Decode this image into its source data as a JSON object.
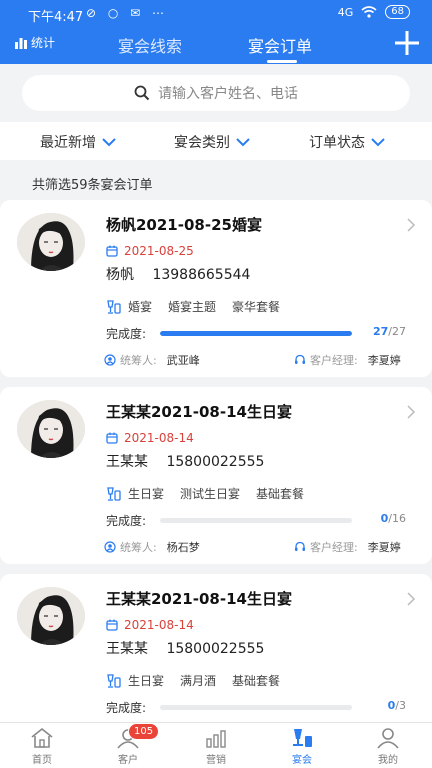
{
  "status_bar": {
    "time": "下午4:47",
    "status_icons": "⊘ ○ ✉ ⋯",
    "network": "4G",
    "battery": "68"
  },
  "header": {
    "stat_label": "统计",
    "tabs": [
      {
        "label": "宴会线索"
      },
      {
        "label": "宴会订单"
      }
    ],
    "active_tab": 1
  },
  "search": {
    "placeholder": "请输入客户姓名、电话"
  },
  "filters": [
    {
      "label": "最近新增"
    },
    {
      "label": "宴会类别"
    },
    {
      "label": "订单状态"
    }
  ],
  "summary": "共筛选59条宴会订单",
  "labels": {
    "progress": "完成度:",
    "coordinator": "统筹人:",
    "manager": "客户经理:"
  },
  "orders": [
    {
      "title": "杨帆2021-08-25婚宴",
      "date": "2021-08-25",
      "name": "杨帆",
      "phone": "13988665544",
      "tags": [
        "婚宴",
        "婚宴主题",
        "豪华套餐"
      ],
      "done": "27",
      "total": "/27",
      "progress": 1.0,
      "coordinator": "武亚峰",
      "manager": "李夏婷"
    },
    {
      "title": "王某某2021-08-14生日宴",
      "date": "2021-08-14",
      "name": "王某某",
      "phone": "15800022555",
      "tags": [
        "生日宴",
        "测试生日宴",
        "基础套餐"
      ],
      "done": "0",
      "total": "/16",
      "progress": 0,
      "coordinator": "杨石梦",
      "manager": "李夏婷"
    },
    {
      "title": "王某某2021-08-14生日宴",
      "date": "2021-08-14",
      "name": "王某某",
      "phone": "15800022555",
      "tags": [
        "生日宴",
        "满月酒",
        "基础套餐"
      ],
      "done": "0",
      "total": "/3",
      "progress": 0,
      "coordinator": "",
      "manager": ""
    }
  ],
  "bottom_nav": {
    "items": [
      {
        "label": "首页"
      },
      {
        "label": "客户"
      },
      {
        "label": "营销"
      },
      {
        "label": "宴会"
      },
      {
        "label": "我的"
      }
    ],
    "badge": "105",
    "active": 3
  },
  "colors": {
    "primary": "#2b7cf0",
    "date_red": "#d9413a",
    "badge_red": "#e94437"
  }
}
